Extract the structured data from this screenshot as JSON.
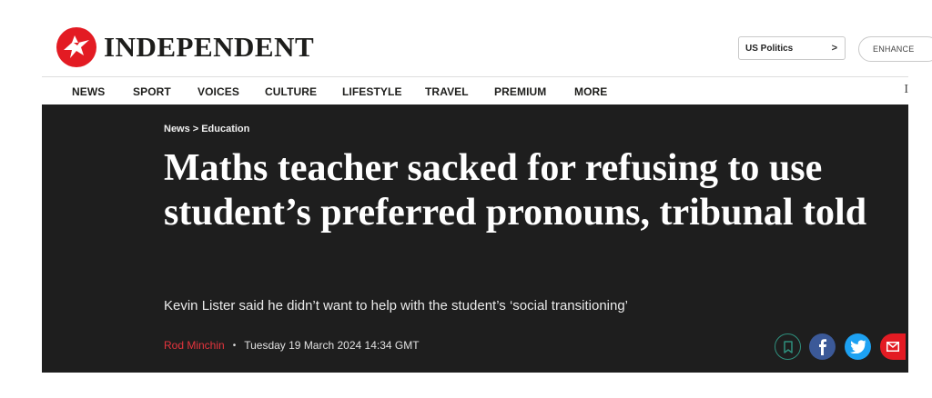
{
  "site": {
    "logo_text": "INDEPENDENT",
    "brand_color": "#e31b23"
  },
  "header": {
    "edition_select": "US Politics",
    "edition_chevron": ">",
    "enhance_label": "ENHANCE"
  },
  "nav": {
    "items": [
      "NEWS",
      "SPORT",
      "VOICES",
      "CULTURE",
      "LIFESTYLE",
      "TRAVEL",
      "PREMIUM",
      "MORE"
    ],
    "edge_glyph": "I"
  },
  "article": {
    "breadcrumb": [
      "News",
      "Education"
    ],
    "breadcrumb_separator": ">",
    "headline": "Maths teacher sacked for refusing to use student’s preferred pronouns, tribunal told",
    "standfirst": "Kevin Lister said he didn’t want to help with the student’s ‘social transitioning’",
    "author": "Rod Minchin",
    "byline_separator": "•",
    "date": "Tuesday 19 March 2024 14:34 GMT",
    "author_color": "#e5343d",
    "background_color": "#1e1e1e"
  },
  "share": {
    "icons": [
      "bookmark-icon",
      "facebook-icon",
      "twitter-icon",
      "email-icon"
    ],
    "colors": {
      "bookmark": "#2f8f7d",
      "facebook": "#3b5998",
      "twitter": "#1da1f2",
      "email": "#e31b23"
    }
  }
}
